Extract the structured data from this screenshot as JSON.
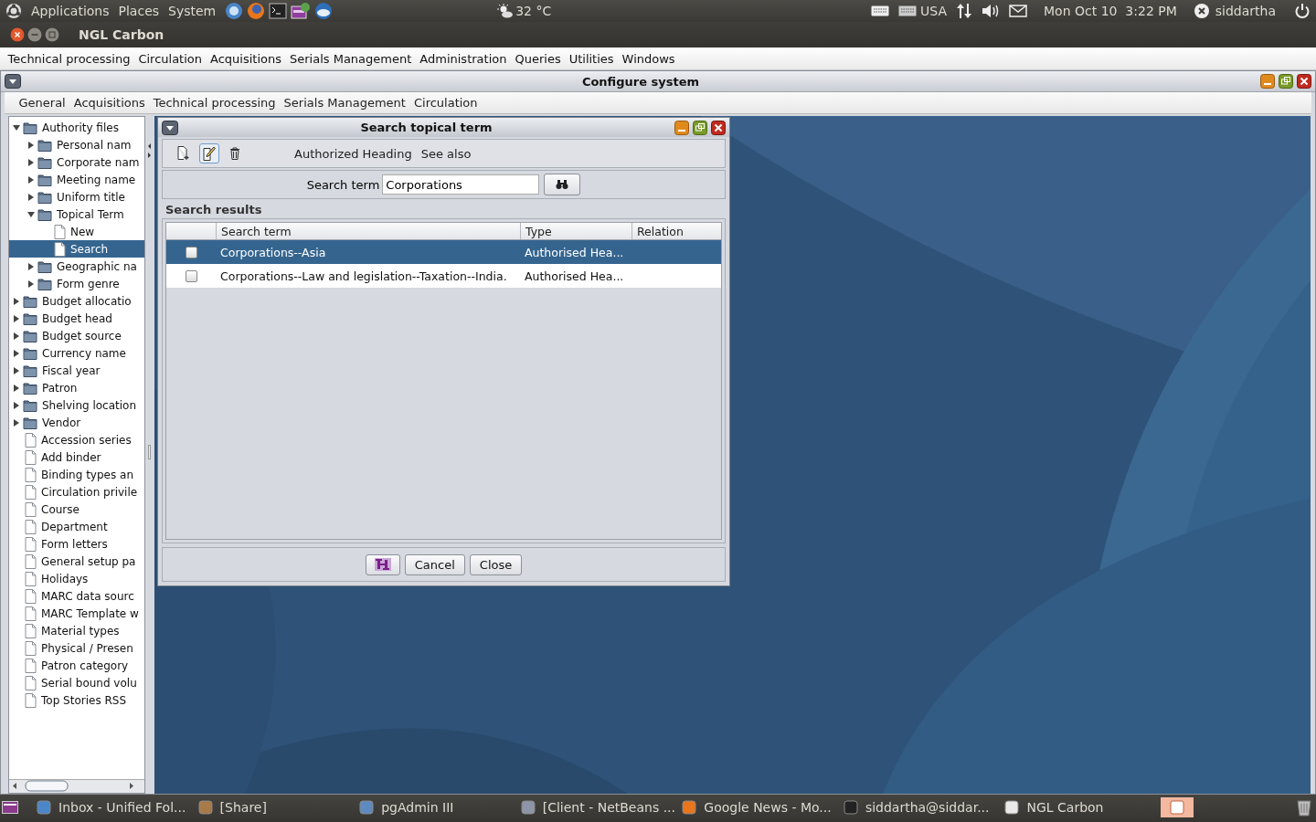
{
  "top_panel": {
    "menus": [
      "Applications",
      "Places",
      "System"
    ],
    "weather": "32 °C",
    "keyboard_layout": "USA",
    "clock": "Mon Oct 10  3:22 PM",
    "user": "siddartha"
  },
  "app_window": {
    "title": "NGL Carbon",
    "menu": [
      "Technical processing",
      "Circulation",
      "Acquisitions",
      "Serials Management",
      "Administration",
      "Queries",
      "Utilities",
      "Windows"
    ]
  },
  "configure_window": {
    "title": "Configure system",
    "menu": [
      "General",
      "Acquisitions",
      "Technical processing",
      "Serials Management",
      "Circulation"
    ],
    "tree": [
      {
        "label": "Authority files",
        "kind": "folder",
        "expanded": true,
        "selected": false,
        "children": [
          {
            "label": "Personal nam",
            "kind": "folder",
            "expanded": false,
            "selected": false
          },
          {
            "label": "Corporate nam",
            "kind": "folder",
            "expanded": false,
            "selected": false
          },
          {
            "label": "Meeting name",
            "kind": "folder",
            "expanded": false,
            "selected": false
          },
          {
            "label": "Uniform title",
            "kind": "folder",
            "expanded": false,
            "selected": false
          },
          {
            "label": "Topical Term",
            "kind": "folder",
            "expanded": true,
            "selected": false,
            "children": [
              {
                "label": "New",
                "kind": "leaf",
                "selected": false
              },
              {
                "label": "Search",
                "kind": "leaf",
                "selected": true
              }
            ]
          },
          {
            "label": "Geographic na",
            "kind": "folder",
            "expanded": false,
            "selected": false
          },
          {
            "label": "Form genre",
            "kind": "folder",
            "expanded": false,
            "selected": false
          }
        ]
      },
      {
        "label": "Budget allocatio",
        "kind": "folder",
        "expanded": false,
        "selected": false
      },
      {
        "label": "Budget head",
        "kind": "folder",
        "expanded": false,
        "selected": false
      },
      {
        "label": "Budget source",
        "kind": "folder",
        "expanded": false,
        "selected": false
      },
      {
        "label": "Currency name",
        "kind": "folder",
        "expanded": false,
        "selected": false
      },
      {
        "label": "Fiscal year",
        "kind": "folder",
        "expanded": false,
        "selected": false
      },
      {
        "label": "Patron",
        "kind": "folder",
        "expanded": false,
        "selected": false
      },
      {
        "label": "Shelving location",
        "kind": "folder",
        "expanded": false,
        "selected": false
      },
      {
        "label": "Vendor",
        "kind": "folder",
        "expanded": false,
        "selected": false
      },
      {
        "label": "Accession series",
        "kind": "leaf",
        "selected": false
      },
      {
        "label": "Add binder",
        "kind": "leaf",
        "selected": false
      },
      {
        "label": "Binding types an",
        "kind": "leaf",
        "selected": false
      },
      {
        "label": "Circulation privile",
        "kind": "leaf",
        "selected": false
      },
      {
        "label": "Course",
        "kind": "leaf",
        "selected": false
      },
      {
        "label": "Department",
        "kind": "leaf",
        "selected": false
      },
      {
        "label": "Form letters",
        "kind": "leaf",
        "selected": false
      },
      {
        "label": "General setup pa",
        "kind": "leaf",
        "selected": false
      },
      {
        "label": "Holidays",
        "kind": "leaf",
        "selected": false
      },
      {
        "label": "MARC data sourc",
        "kind": "leaf",
        "selected": false
      },
      {
        "label": "MARC Template w",
        "kind": "leaf",
        "selected": false
      },
      {
        "label": "Material types",
        "kind": "leaf",
        "selected": false
      },
      {
        "label": "Physical / Presen",
        "kind": "leaf",
        "selected": false
      },
      {
        "label": "Patron category",
        "kind": "leaf",
        "selected": false
      },
      {
        "label": "Serial bound volu",
        "kind": "leaf",
        "selected": false
      },
      {
        "label": "Top Stories RSS",
        "kind": "leaf",
        "selected": false
      }
    ]
  },
  "search_window": {
    "title": "Search topical term",
    "toolbar_tabs": [
      "Authorized Heading",
      "See also"
    ],
    "search_label": "Search term",
    "search_value": "Corporations",
    "results_label": "Search results",
    "table": {
      "columns": [
        "Search term",
        "Type",
        "Relation"
      ],
      "rows": [
        {
          "checked": false,
          "selected": true,
          "cells": [
            "Corporations--Asia",
            "Authorised Hea..."
          ]
        },
        {
          "checked": false,
          "selected": false,
          "cells": [
            "Corporations--Law and legislation--Taxation--India.",
            "Authorised Hea..."
          ]
        }
      ]
    },
    "buttons": [
      "Cancel",
      "Close"
    ]
  },
  "taskbar": [
    {
      "label": "Inbox - Unified Fol..."
    },
    {
      "label": "[Share]"
    },
    {
      "label": "pgAdmin III"
    },
    {
      "label": "[Client - NetBeans ..."
    },
    {
      "label": "Google News - Mo..."
    },
    {
      "label": "siddartha@siddar..."
    },
    {
      "label": "NGL Carbon"
    }
  ]
}
